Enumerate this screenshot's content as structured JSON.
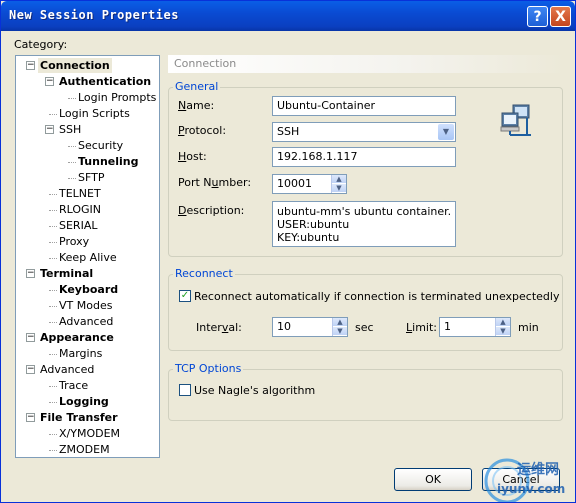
{
  "window": {
    "title": "New Session Properties"
  },
  "titlebar_buttons": {
    "help": "?",
    "close": "X"
  },
  "category_label": "Category:",
  "tree": [
    {
      "label": "Connection",
      "level": 0,
      "bold": true,
      "selected": true,
      "expander": "minus"
    },
    {
      "label": "Authentication",
      "level": 1,
      "bold": true,
      "expander": "minus"
    },
    {
      "label": "Login Prompts",
      "level": 2
    },
    {
      "label": "Login Scripts",
      "level": 1
    },
    {
      "label": "SSH",
      "level": 1,
      "expander": "minus"
    },
    {
      "label": "Security",
      "level": 2
    },
    {
      "label": "Tunneling",
      "level": 2,
      "bold": true
    },
    {
      "label": "SFTP",
      "level": 2
    },
    {
      "label": "TELNET",
      "level": 1
    },
    {
      "label": "RLOGIN",
      "level": 1
    },
    {
      "label": "SERIAL",
      "level": 1
    },
    {
      "label": "Proxy",
      "level": 1
    },
    {
      "label": "Keep Alive",
      "level": 1
    },
    {
      "label": "Terminal",
      "level": 0,
      "bold": true,
      "expander": "minus"
    },
    {
      "label": "Keyboard",
      "level": 1,
      "bold": true
    },
    {
      "label": "VT Modes",
      "level": 1
    },
    {
      "label": "Advanced",
      "level": 1
    },
    {
      "label": "Appearance",
      "level": 0,
      "bold": true,
      "expander": "minus"
    },
    {
      "label": "Margins",
      "level": 1
    },
    {
      "label": "Advanced",
      "level": 0,
      "expander": "minus"
    },
    {
      "label": "Trace",
      "level": 1
    },
    {
      "label": "Logging",
      "level": 1,
      "bold": true
    },
    {
      "label": "File Transfer",
      "level": 0,
      "bold": true,
      "expander": "minus"
    },
    {
      "label": "X/YMODEM",
      "level": 1
    },
    {
      "label": "ZMODEM",
      "level": 1
    }
  ],
  "panel": {
    "header": "Connection",
    "general": {
      "title": "General",
      "name_label": "Name:",
      "name_value": "Ubuntu-Container",
      "protocol_label": "Protocol:",
      "protocol_value": "SSH",
      "host_label": "Host:",
      "host_value": "192.168.1.117",
      "port_label": "Port Number:",
      "port_value": "10001",
      "description_label": "Description:",
      "description_lines": [
        "ubuntu-mm's ubuntu container.",
        "USER:ubuntu",
        "KEY:ubuntu"
      ]
    },
    "reconnect": {
      "title": "Reconnect",
      "auto_label": "Reconnect automatically if connection is terminated unexpectedly",
      "auto_checked": true,
      "interval_label": "Interval:",
      "interval_value": "10",
      "interval_unit": "sec",
      "limit_label": "Limit:",
      "limit_value": "1",
      "limit_unit": "min"
    },
    "tcp": {
      "title": "TCP Options",
      "nagle_label": "Use Nagle's algorithm",
      "nagle_checked": false
    }
  },
  "buttons": {
    "ok": "OK",
    "cancel": "Cancel"
  },
  "watermark": {
    "text_cn": "运维网",
    "text_url": "iyunv.com"
  }
}
